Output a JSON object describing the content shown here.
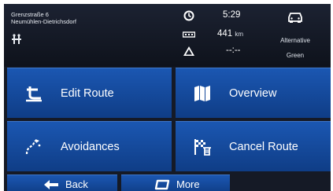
{
  "location": {
    "street": "Grenzstraße 6",
    "district": "Neumühlen-Dietrichsdorf"
  },
  "status": {
    "time": "5:29",
    "distance_value": "441",
    "distance_unit": "km",
    "eta": "--:--"
  },
  "route": {
    "vehicle_icon": "car-icon",
    "type_line1": "Alternative",
    "type_line2": "Green"
  },
  "buttons": {
    "edit_route": "Edit Route",
    "overview": "Overview",
    "avoidances": "Avoidances",
    "cancel_route": "Cancel Route"
  },
  "bottom": {
    "back": "Back",
    "more": "More"
  },
  "colors": {
    "button_blue": "#1b57b2",
    "background": "#151a26",
    "warning_yellow": "#f1c40f"
  }
}
